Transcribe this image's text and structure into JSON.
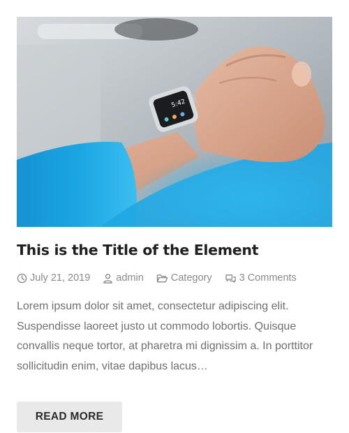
{
  "post": {
    "title": "This is the Title of the Element",
    "date": "July 21, 2019",
    "author": "admin",
    "category": "Category",
    "comments": "3 Comments",
    "excerpt": "Lorem ipsum dolor sit amet, consectetur adipiscing elit. Suspendisse laoreet justo ut commodo lobortis. Quisque convallis neque tortor, at pharetra mi dignissim a. In porttitor sollicitudin enim, vitae dapibus lacus…",
    "read_more_label": "READ MORE",
    "image": {
      "description_icon": "smartwatch-photo",
      "watch_time": "5:42"
    }
  },
  "icons": {
    "date": "clock-icon",
    "author": "user-icon",
    "category": "folder-icon",
    "comments": "comments-icon"
  },
  "colors": {
    "title": "#1f1f1f",
    "meta": "#8a8a8a",
    "text": "#6f6f6f",
    "button_bg": "#e9e9e9",
    "button_text": "#2b2b2b",
    "sleeve_blue": "#1a9fdc"
  }
}
